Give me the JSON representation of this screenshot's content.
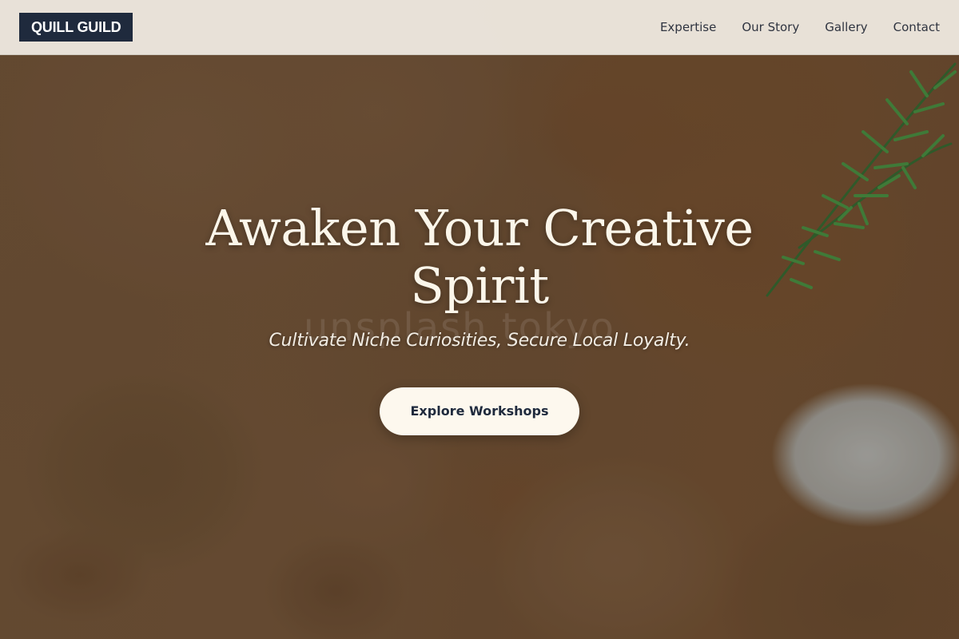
{
  "brand": {
    "name": "QUILL GUILD"
  },
  "nav": {
    "items": [
      {
        "label": "Expertise"
      },
      {
        "label": "Our Story"
      },
      {
        "label": "Gallery"
      },
      {
        "label": "Contact"
      }
    ]
  },
  "hero": {
    "headline": "Awaken Your Creative Spirit",
    "tagline": "Cultivate Niche Curiosities, Secure Local Loyalty.",
    "cta_label": "Explore Workshops",
    "watermark": "unsplash tokyo"
  },
  "colors": {
    "brand": "#1f2a3d",
    "nav_background": "#f0ebe2",
    "cta_background": "#fdf8ee",
    "headline_text": "#fbf6ea"
  },
  "icons": {
    "background_art": "painted-palette-image",
    "decoration": "rosemary-sprig-icon"
  }
}
